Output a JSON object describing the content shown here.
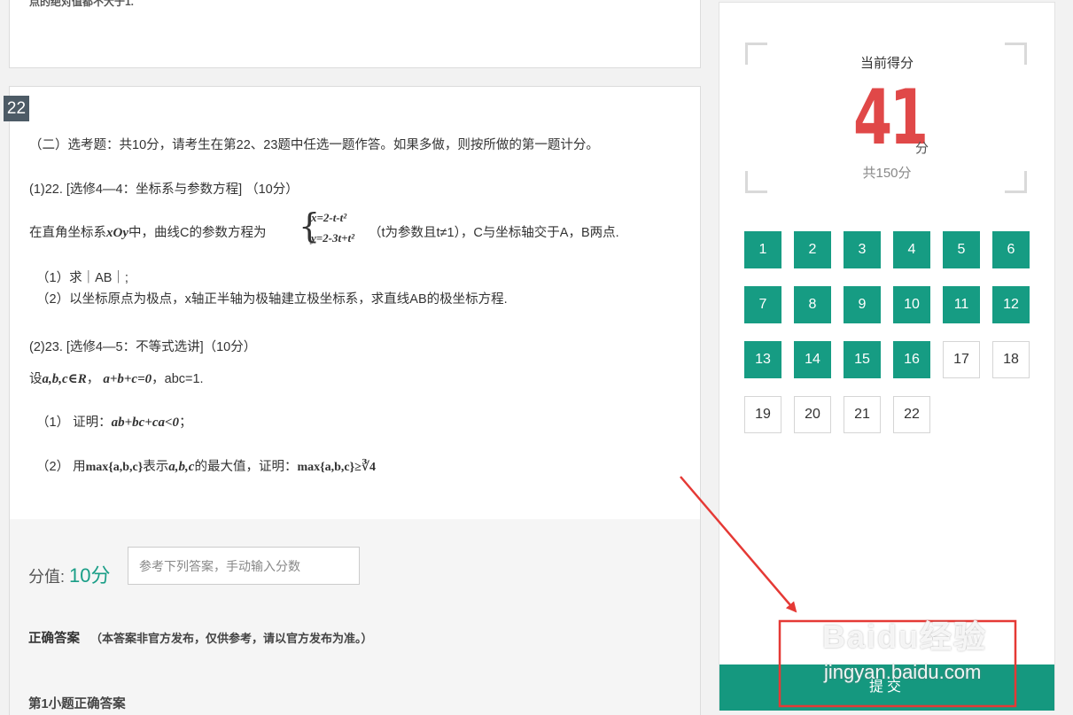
{
  "prev_question": {
    "tail_text": "点的绝对值都不大于1."
  },
  "question": {
    "number": "22",
    "intro": "（二）选考题：共10分，请考生在第22、23题中任选一题作答。如果多做，则按所做的第一题计分。",
    "p1_title": "(1)22. [选修4—4：坐标系与参数方程] （10分）",
    "p1_stem_a": "在直角坐标系",
    "p1_stem_math": "xOy",
    "p1_stem_b": "中，曲线C的参数方程为",
    "p1_eq1": "x=2-t-t²",
    "p1_eq2": "y=2-3t+t²",
    "p1_stem_c": "（t为参数且t≠1），C与坐标轴交于A，B两点.",
    "p1_sub1": "（1）求｜AB｜;",
    "p1_sub2": "（2）以坐标原点为极点，x轴正半轴为极轴建立极坐标系，求直线AB的极坐标方程.",
    "p2_title": "(2)23. [选修4—5：不等式选讲]（10分）",
    "p2_stem_a": "设",
    "p2_stem_m1": "a,b,c∈R",
    "p2_stem_sep": "，",
    "p2_stem_m2": "a+b+c=0",
    "p2_stem_b": "，abc=1.",
    "p2_sub1_a": "（1）  证明：",
    "p2_sub1_m": "ab+bc+ca<0",
    "p2_sub1_b": "；",
    "p2_sub2_a": "（2）  用",
    "p2_sub2_m1": "max{a,b,c}",
    "p2_sub2_b": "表示",
    "p2_sub2_m2": "a,b,c",
    "p2_sub2_c": "的最大值，证明：",
    "p2_sub2_m3": "max{a,b,c}≥∛4"
  },
  "scoring": {
    "label": "分值: ",
    "value": "10分",
    "input_placeholder": "参考下列答案，手动输入分数",
    "answer_title": "正确答案",
    "answer_note": "（本答案非官方发布，仅供参考，请以官方发布为准。）",
    "sub_answer_title": "第1小题正确答案"
  },
  "sidebar": {
    "current_label": "当前得分",
    "score": "41",
    "score_unit": "分",
    "total": "共150分",
    "questions": [
      {
        "n": "1",
        "done": true
      },
      {
        "n": "2",
        "done": true
      },
      {
        "n": "3",
        "done": true
      },
      {
        "n": "4",
        "done": true
      },
      {
        "n": "5",
        "done": true
      },
      {
        "n": "6",
        "done": true
      },
      {
        "n": "7",
        "done": true
      },
      {
        "n": "8",
        "done": true
      },
      {
        "n": "9",
        "done": true
      },
      {
        "n": "10",
        "done": true
      },
      {
        "n": "11",
        "done": true
      },
      {
        "n": "12",
        "done": true
      },
      {
        "n": "13",
        "done": true
      },
      {
        "n": "14",
        "done": true
      },
      {
        "n": "15",
        "done": true
      },
      {
        "n": "16",
        "done": true
      },
      {
        "n": "17",
        "done": false
      },
      {
        "n": "18",
        "done": false
      },
      {
        "n": "19",
        "done": false
      },
      {
        "n": "20",
        "done": false
      },
      {
        "n": "21",
        "done": false
      },
      {
        "n": "22",
        "done": false
      }
    ],
    "submit_label": "提交"
  },
  "annotation": {
    "color": "#e53935"
  },
  "watermark": {
    "main": "Baidu经验",
    "sub": "jingyan.baidu.com"
  },
  "colors": {
    "accent": "#169c83",
    "score": "#e04848",
    "badge": "#4d5b66"
  }
}
